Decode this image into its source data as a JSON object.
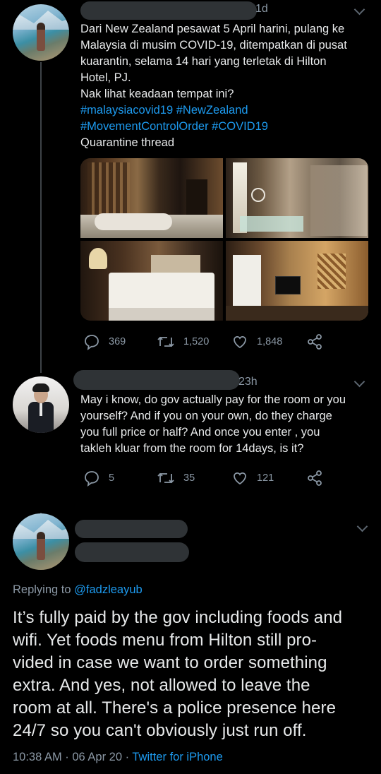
{
  "tweet1": {
    "time": "1d",
    "text_lines": [
      "Dari New Zealand pesawat 5 April harini, pulang ke",
      "Malaysia di musim COVID-19, ditempatkan di pusat",
      "kuarantin, selama 14 hari yang terletak di Hilton",
      "Hotel, PJ.",
      "Nak lihat keadaan tempat ini?"
    ],
    "hashtags_line1": "#malaysiacovid19 #NewZealand",
    "hashtags_line2": "#MovementControlOrder #COVID19",
    "tail": "Quarantine thread",
    "replies": "369",
    "retweets": "1,520",
    "likes": "1,848",
    "photos": [
      "hotel-bathroom-tub",
      "hotel-bathroom-shower",
      "hotel-bedroom-bed",
      "hotel-room-tv-wall"
    ]
  },
  "tweet2": {
    "time": "23h",
    "text_lines": [
      "May i know, do gov actually pay for the room or you",
      "yourself? And if you on your own, do they charge",
      "you full price or half? And once you enter , you",
      "takleh kluar from the room for 14days, is it?"
    ],
    "replies": "5",
    "retweets": "35",
    "likes": "121"
  },
  "tweet3": {
    "replying_prefix": "Replying to ",
    "replying_handle": "@fadzleayub",
    "body_lines": [
      "It’s fully paid by the gov including foods and",
      "wifi. Yet foods menu from Hilton still pro-",
      "vided in case we want to order something",
      "extra. And yes, not allowed to leave the",
      "room at all. There's a police presence here",
      "24/7 so you can't obviously just run off."
    ],
    "timestamp": "10:38 AM · 06 Apr 20 · ",
    "source": "Twitter for iPhone"
  },
  "colors": {
    "background": "#000000",
    "text": "#e7e9ea",
    "muted": "#8b98a5",
    "link": "#1d9bf0"
  }
}
